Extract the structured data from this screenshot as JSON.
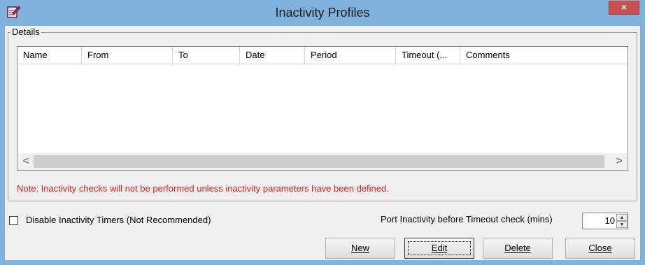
{
  "window": {
    "title": "Inactivity Profiles",
    "icon": "notepad-pencil-icon",
    "close_symbol": "×",
    "accent": "#7fb2dd",
    "close_color": "#c74f4f"
  },
  "details": {
    "group_label": "Details",
    "columns": [
      "Name",
      "From",
      "To",
      "Date",
      "Period",
      "Timeout (...",
      "Comments"
    ],
    "rows": [],
    "scroll_left_symbol": "<",
    "scroll_right_symbol": ">"
  },
  "note": {
    "text": "Note:  Inactivity checks will not be performed unless inactivity parameters have been defined.",
    "color": "#e21b1b"
  },
  "options": {
    "disable_timers_label": "Disable Inactivity Timers (Not Recommended)",
    "disable_timers_checked": false,
    "port_inactivity_label": "Port Inactivity before Timeout check (mins)",
    "port_inactivity_value": "10"
  },
  "buttons": {
    "new": "New",
    "edit": "Edit",
    "delete": "Delete",
    "close": "Close"
  }
}
